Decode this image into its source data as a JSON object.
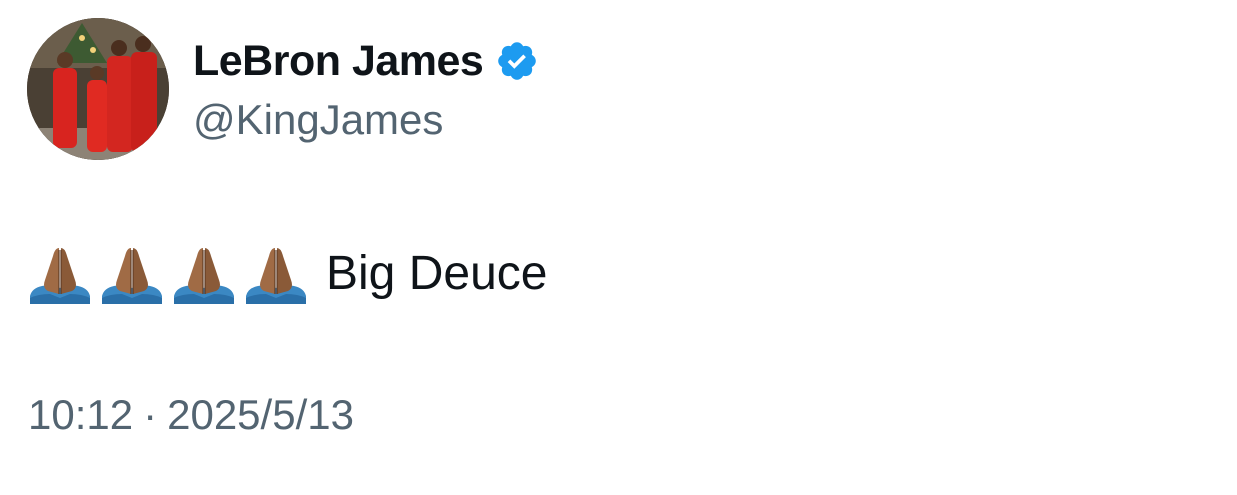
{
  "author": {
    "display_name": "LeBron James",
    "handle": "@KingJames",
    "verified": true,
    "avatar_icon": "profile-photo-family-red-outfits"
  },
  "tweet": {
    "emoji_icons": [
      "folded-hands-emoji",
      "folded-hands-emoji",
      "folded-hands-emoji",
      "folded-hands-emoji"
    ],
    "text": "Big Deuce"
  },
  "meta": {
    "time": "10:12",
    "separator": "·",
    "date": "2025/5/13"
  },
  "colors": {
    "text_primary": "#0f1419",
    "text_secondary": "#536471",
    "verified_blue": "#1d9bf0"
  }
}
